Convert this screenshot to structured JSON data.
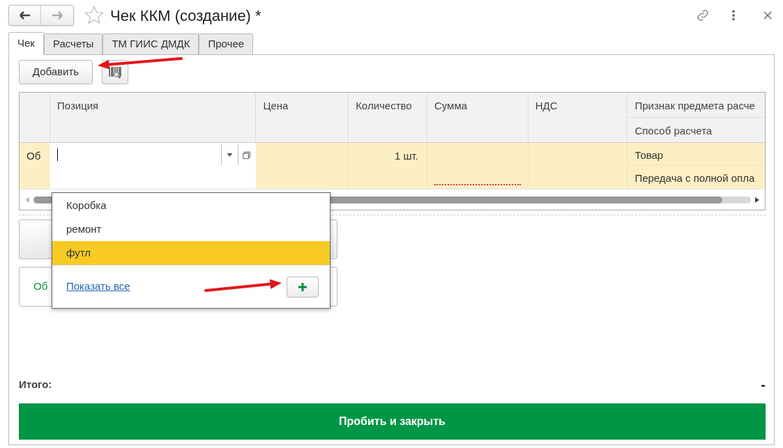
{
  "window": {
    "title": "Чек ККМ (создание) *"
  },
  "tabs": [
    {
      "label": "Чек",
      "selected": true
    },
    {
      "label": "Расчеты",
      "selected": false
    },
    {
      "label": "ТМ ГИИС ДМДК",
      "selected": false
    },
    {
      "label": "Прочее",
      "selected": false
    }
  ],
  "toolbar": {
    "add_button": "Добавить"
  },
  "table": {
    "columns": [
      {
        "label": "Позиция"
      },
      {
        "label": "Цена"
      },
      {
        "label": "Количество"
      },
      {
        "label": "Сумма"
      },
      {
        "label": "НДС"
      },
      {
        "label": "Признак предмета расче",
        "sublabel": "Способ расчета"
      }
    ],
    "rows": [
      {
        "marker": "Об",
        "quantity": "1 шт.",
        "subject": "Товар",
        "method": "Передача с полной опла",
        "sum_required": true
      }
    ]
  },
  "dropdown": {
    "items": [
      {
        "label": "Коробка",
        "selected": false
      },
      {
        "label": "ремонт",
        "selected": false
      },
      {
        "label": "футл",
        "selected": true
      }
    ],
    "show_all": "Показать все"
  },
  "covered_box": {
    "text": "Об"
  },
  "total": {
    "label": "Итого:",
    "value": "-"
  },
  "submit_button": "Пробить и закрыть"
}
